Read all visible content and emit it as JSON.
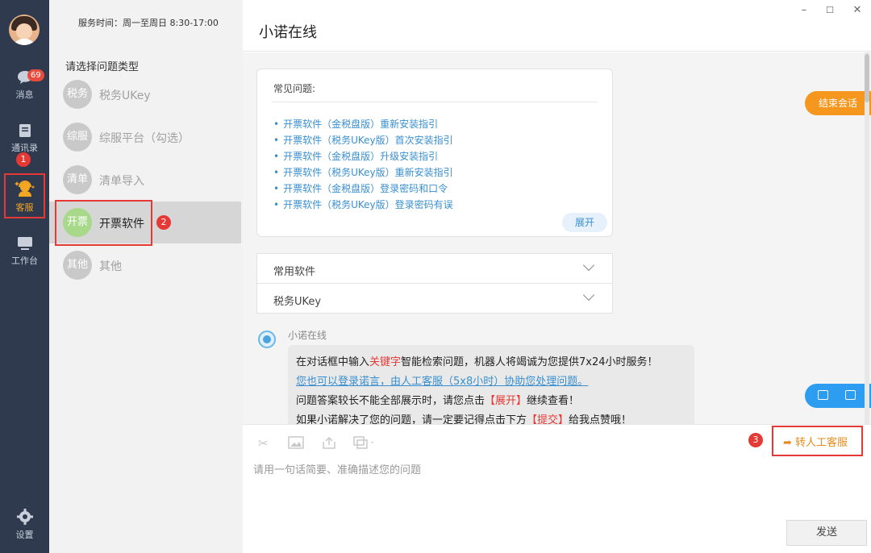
{
  "sidebar": {
    "badge": "69",
    "items": [
      {
        "label": "消息",
        "icon": "message-icon"
      },
      {
        "label": "通讯录",
        "icon": "contacts-icon"
      },
      {
        "label": "客服",
        "icon": "customer-service-icon"
      },
      {
        "label": "工作台",
        "icon": "workbench-icon"
      },
      {
        "label": "设置",
        "icon": "settings-icon"
      }
    ]
  },
  "panel": {
    "service_time": "服务时间：周一至周日 8:30-17:00",
    "title": "请选择问题类型",
    "categories": [
      {
        "short": "税务",
        "label": "税务UKey"
      },
      {
        "short": "综服",
        "label": "综服平台（勾选）"
      },
      {
        "short": "清单",
        "label": "清单导入"
      },
      {
        "short": "开票",
        "label": "开票软件"
      },
      {
        "short": "其他",
        "label": "其他"
      }
    ]
  },
  "markers": [
    "1",
    "2",
    "3"
  ],
  "chat": {
    "title": "小诺在线",
    "window_controls": [
      "–",
      "☐",
      "✕"
    ],
    "faq_title": "常见问题:",
    "faq": [
      "开票软件（金税盘版）重新安装指引",
      "开票软件（税务UKey版）首次安装指引",
      "开票软件（金税盘版）升级安装指引",
      "开票软件（税务UKey版）重新安装指引",
      "开票软件（金税盘版）登录密码和口令",
      "开票软件（税务UKey版）登录密码有误"
    ],
    "expand_label": "展开",
    "accordion": [
      "常用软件",
      "税务UKey"
    ],
    "bot_name": "小诺在线",
    "message": {
      "l1_a": "在对话框中输入",
      "l1_red": "关键字",
      "l1_b": "智能检索问题，机器人将竭诚为您提供7x24小时服务！",
      "l2_link": "您也可以登录诺言，由人工客服（5x8小时）协助您处理问题。",
      "l3_a": "问题答案较长不能全部展示时，请您点击",
      "l3_red": "【展开】",
      "l3_b": "继续查看！",
      "l4_a": "如果小诺解决了您的问题，请一定要记得点击下方",
      "l4_red": "【提交】",
      "l4_b": "给我点赞哦！"
    },
    "end_chat": "结束会话"
  },
  "input": {
    "placeholder": "请用一句话简要、准确描述您的问题",
    "transfer": "转人工客服",
    "send": "发送"
  },
  "colors": {
    "rail": "#2f3a4f",
    "accent_orange": "#f5961f",
    "link_blue": "#3a8fd0",
    "marker_red": "#e53935"
  }
}
